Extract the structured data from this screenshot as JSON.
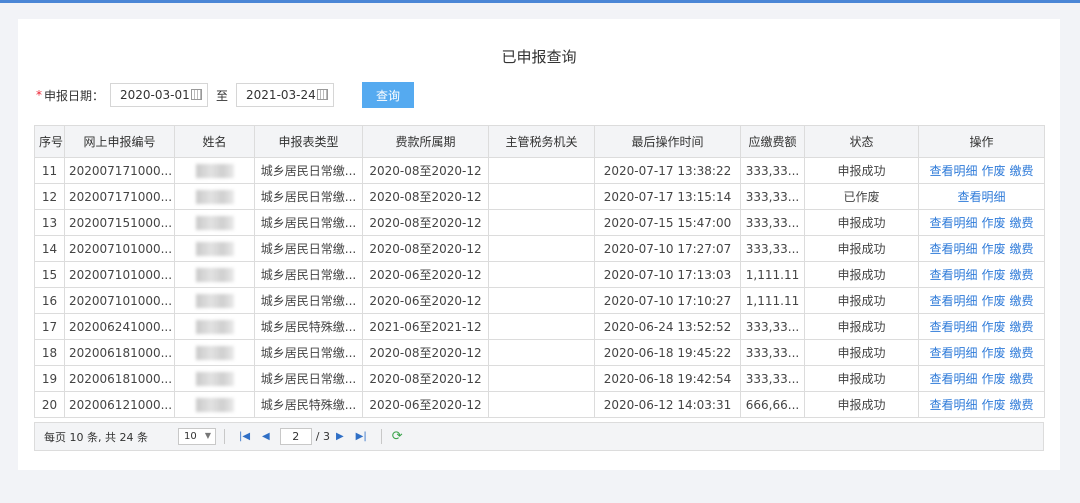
{
  "page_title": "已申报查询",
  "filter": {
    "required_mark": "*",
    "label": "申报日期：",
    "start_date": "2020-03-01",
    "to_label": "至",
    "end_date": "2021-03-24",
    "query_button": "查询"
  },
  "table": {
    "headers": [
      "序号",
      "网上申报编号",
      "姓名",
      "申报表类型",
      "费款所属期",
      "主管税务机关",
      "最后操作时间",
      "应缴费额",
      "状态",
      "操作"
    ],
    "rows": [
      {
        "no": "11",
        "id": "202007171000...",
        "name": "",
        "type": "城乡居民日常缴...",
        "period": "2020-08至2020-12",
        "authority": "",
        "time": "2020-07-17 13:38:22",
        "amount": "333,33...",
        "status": "申报成功",
        "ops": [
          "查看明细",
          "作废",
          "缴费"
        ]
      },
      {
        "no": "12",
        "id": "202007171000...",
        "name": "",
        "type": "城乡居民日常缴...",
        "period": "2020-08至2020-12",
        "authority": "",
        "time": "2020-07-17 13:15:14",
        "amount": "333,33...",
        "status": "已作废",
        "ops": [
          "查看明细"
        ]
      },
      {
        "no": "13",
        "id": "202007151000...",
        "name": "",
        "type": "城乡居民日常缴...",
        "period": "2020-08至2020-12",
        "authority": "",
        "time": "2020-07-15 15:47:00",
        "amount": "333,33...",
        "status": "申报成功",
        "ops": [
          "查看明细",
          "作废",
          "缴费"
        ]
      },
      {
        "no": "14",
        "id": "202007101000...",
        "name": "",
        "type": "城乡居民日常缴...",
        "period": "2020-08至2020-12",
        "authority": "",
        "time": "2020-07-10 17:27:07",
        "amount": "333,33...",
        "status": "申报成功",
        "ops": [
          "查看明细",
          "作废",
          "缴费"
        ]
      },
      {
        "no": "15",
        "id": "202007101000...",
        "name": "",
        "type": "城乡居民日常缴...",
        "period": "2020-06至2020-12",
        "authority": "",
        "time": "2020-07-10 17:13:03",
        "amount": "1,111.11",
        "status": "申报成功",
        "ops": [
          "查看明细",
          "作废",
          "缴费"
        ]
      },
      {
        "no": "16",
        "id": "202007101000...",
        "name": "",
        "type": "城乡居民日常缴...",
        "period": "2020-06至2020-12",
        "authority": "",
        "time": "2020-07-10 17:10:27",
        "amount": "1,111.11",
        "status": "申报成功",
        "ops": [
          "查看明细",
          "作废",
          "缴费"
        ]
      },
      {
        "no": "17",
        "id": "202006241000...",
        "name": "",
        "type": "城乡居民特殊缴...",
        "period": "2021-06至2021-12",
        "authority": "",
        "time": "2020-06-24 13:52:52",
        "amount": "333,33...",
        "status": "申报成功",
        "ops": [
          "查看明细",
          "作废",
          "缴费"
        ]
      },
      {
        "no": "18",
        "id": "202006181000...",
        "name": "",
        "type": "城乡居民日常缴...",
        "period": "2020-08至2020-12",
        "authority": "",
        "time": "2020-06-18 19:45:22",
        "amount": "333,33...",
        "status": "申报成功",
        "ops": [
          "查看明细",
          "作废",
          "缴费"
        ]
      },
      {
        "no": "19",
        "id": "202006181000...",
        "name": "",
        "type": "城乡居民日常缴...",
        "period": "2020-08至2020-12",
        "authority": "",
        "time": "2020-06-18 19:42:54",
        "amount": "333,33...",
        "status": "申报成功",
        "ops": [
          "查看明细",
          "作废",
          "缴费"
        ]
      },
      {
        "no": "20",
        "id": "202006121000...",
        "name": "",
        "type": "城乡居民特殊缴...",
        "period": "2020-06至2020-12",
        "authority": "",
        "time": "2020-06-12 14:03:31",
        "amount": "666,66...",
        "status": "申报成功",
        "ops": [
          "查看明细",
          "作废",
          "缴费"
        ]
      }
    ]
  },
  "pager": {
    "summary": "每页 10 条, 共 24 条",
    "page_size": "10",
    "current_page": "2",
    "total_pages": "/ 3",
    "icons": {
      "first": "first-page-icon",
      "prev": "prev-page-icon",
      "next": "next-page-icon",
      "last": "last-page-icon",
      "refresh": "refresh-icon"
    }
  },
  "colors": {
    "accent": "#55aaf0",
    "link": "#2f7bd9",
    "header_bg": "#f3f4f6",
    "stripe": "#4b86d6"
  }
}
